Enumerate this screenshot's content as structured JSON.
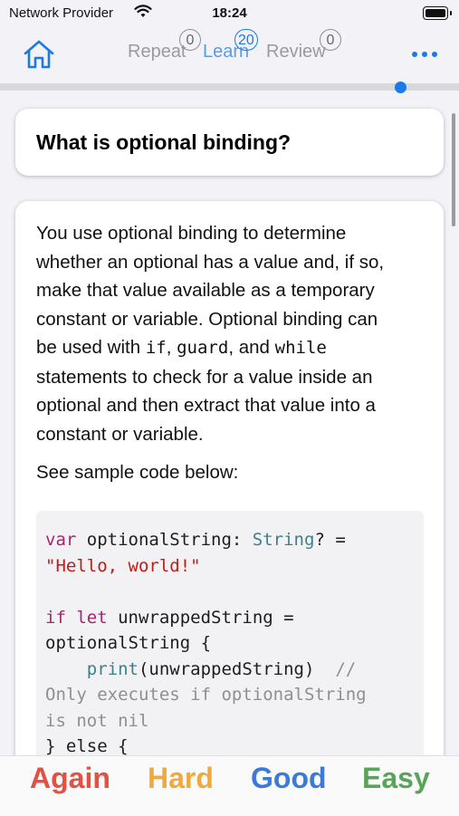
{
  "status_bar": {
    "carrier": "Network Provider",
    "time": "18:24"
  },
  "nav": {
    "tabs": [
      {
        "label": "Repeat",
        "count": "0"
      },
      {
        "label": "Learn",
        "count": "20"
      },
      {
        "label": "Review",
        "count": "0"
      }
    ],
    "home_icon": "house-icon",
    "more_icon": "ellipsis-icon"
  },
  "question": "What is optional binding?",
  "answer": {
    "paragraph_lines": [
      "You use optional binding to determine",
      "whether an optional has a value and, if so,",
      "make that value available as a temporary",
      "constant or variable. Optional binding can",
      "be used with",
      "statements to check for a value inside an",
      "optional and then extract that value into a",
      "constant or variable."
    ],
    "inline_code": [
      "if",
      "guard",
      "while"
    ],
    "inline_joiners": [
      ",",
      ", and"
    ],
    "sample_label": "See sample code below:",
    "code": {
      "l1_kw": "var",
      "l1_name": " optionalString: ",
      "l1_type": "String",
      "l1_rest": "? =",
      "l2_str": "\"Hello, world!\"",
      "l4_kw1": "if",
      "l4_kw2": "let",
      "l4_rest": " unwrappedString =",
      "l5": "optionalString {",
      "l6_fn": "print",
      "l6_rest": "(unwrappedString)  ",
      "l6_cm": "//",
      "l7_cm": "Only executes if optionalString",
      "l8_cm": "is not nil",
      "l9": "} else {"
    }
  },
  "actions": {
    "again": "Again",
    "hard": "Hard",
    "good": "Good",
    "easy": "Easy"
  },
  "colors": {
    "accent": "#1a7ae8",
    "again": "#e05244",
    "hard": "#f0a93a",
    "good": "#3b7ad6",
    "easy": "#58a55a"
  }
}
